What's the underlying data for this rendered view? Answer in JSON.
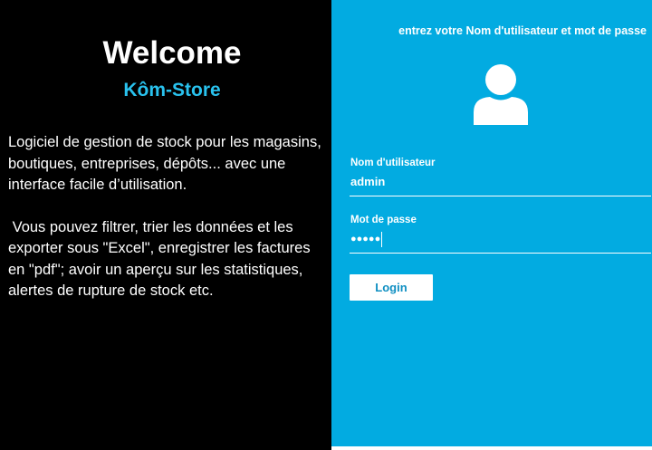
{
  "colors": {
    "left_background": "#000000",
    "right_background": "#02abe1",
    "brand_accent": "#29c2ee",
    "login_text": "#0f8fc2"
  },
  "left": {
    "welcome_title": "Welcome",
    "brand_name": "Kôm-Store",
    "paragraph_1": "Logiciel de gestion de stock pour les magasins, boutiques, entreprises, dépôts... avec une interface facile d’utilisation.",
    "paragraph_2": "Vous pouvez filtrer, trier les données et les exporter sous \"Excel\", enregistrer les factures en \"pdf\"; avoir un aperçu sur les statistiques, alertes de rupture de stock etc."
  },
  "login_form": {
    "instruction": "entrez votre Nom d'utilisateur et mot de passe",
    "user_icon": "user-icon",
    "username_label": "Nom d'utilisateur",
    "username_value": "admin",
    "password_label": "Mot de passe",
    "password_value": "●●●●●",
    "login_button_label": "Login"
  }
}
